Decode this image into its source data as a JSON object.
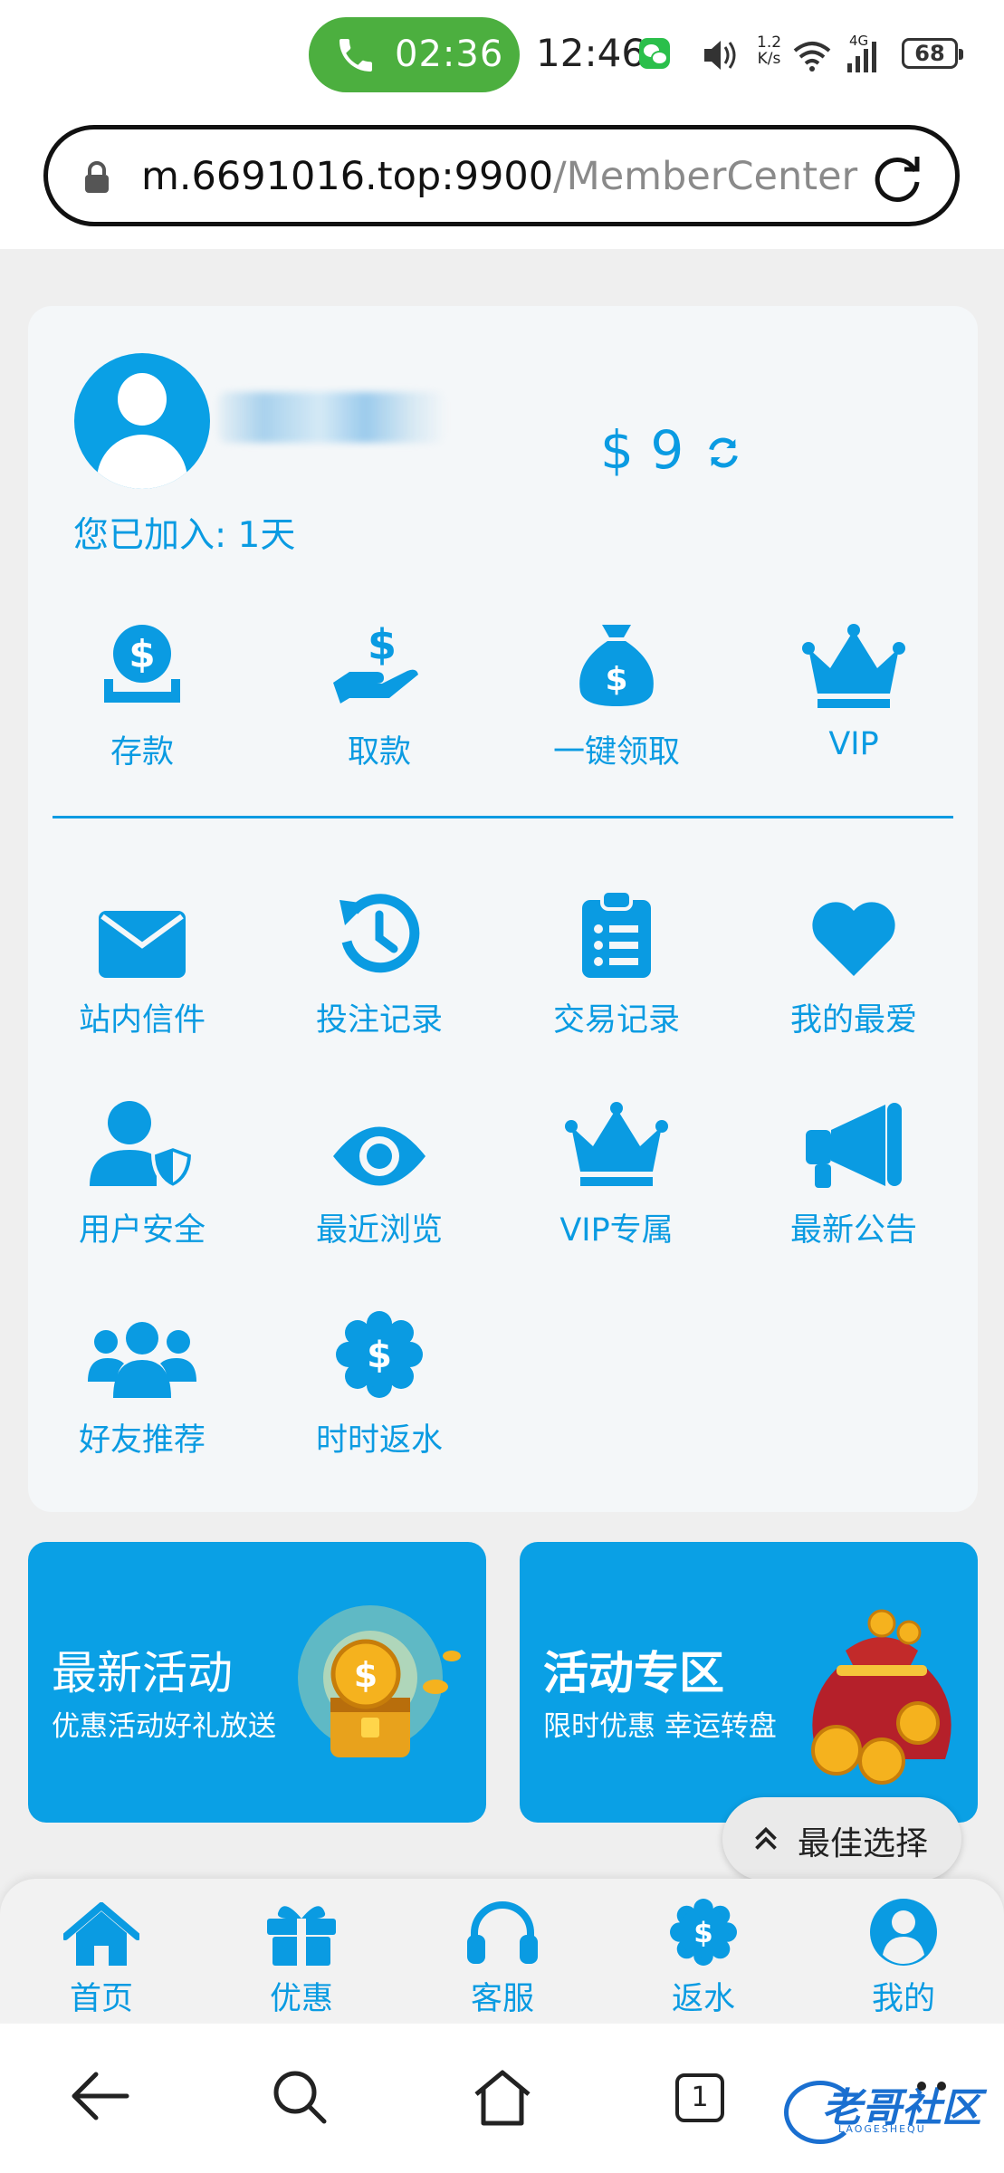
{
  "status_bar": {
    "call_time": "02:36",
    "clock": "12:46",
    "net_speed_value": "1.2",
    "net_speed_unit": "K/s",
    "network": "4G",
    "battery": "68"
  },
  "address_bar": {
    "host": "m.6691016.top:9900",
    "path": "/MemberCenter"
  },
  "member": {
    "joined": "您已加入: 1天",
    "balance": "$ 9"
  },
  "quick_actions": [
    {
      "label": "存款",
      "icon": "deposit-icon"
    },
    {
      "label": "取款",
      "icon": "withdraw-icon"
    },
    {
      "label": "一键领取",
      "icon": "money-bag-icon"
    },
    {
      "label": "VIP",
      "icon": "crown-icon"
    }
  ],
  "menu": [
    {
      "label": "站内信件",
      "icon": "envelope-icon"
    },
    {
      "label": "投注记录",
      "icon": "history-icon"
    },
    {
      "label": "交易记录",
      "icon": "clipboard-icon"
    },
    {
      "label": "我的最爱",
      "icon": "heart-icon"
    },
    {
      "label": "用户安全",
      "icon": "user-shield-icon"
    },
    {
      "label": "最近浏览",
      "icon": "eye-icon"
    },
    {
      "label": "VIP专属",
      "icon": "crown-icon"
    },
    {
      "label": "最新公告",
      "icon": "megaphone-icon"
    },
    {
      "label": "好友推荐",
      "icon": "users-icon"
    },
    {
      "label": "时时返水",
      "icon": "dollar-badge-icon"
    }
  ],
  "promos": [
    {
      "title": "最新活动",
      "subtitle": "优惠活动好礼放送"
    },
    {
      "title": "活动专区",
      "subtitle": "限时优惠 幸运转盘"
    }
  ],
  "best_choice": "最佳选择",
  "bottom_nav": [
    {
      "label": "首页",
      "icon": "home-icon"
    },
    {
      "label": "优惠",
      "icon": "gift-icon"
    },
    {
      "label": "客服",
      "icon": "headset-icon"
    },
    {
      "label": "返水",
      "icon": "dollar-badge-icon"
    },
    {
      "label": "我的",
      "icon": "user-circle-icon"
    }
  ],
  "browser": {
    "tab_count": "1"
  },
  "watermark": {
    "text": "老哥社区",
    "sub": "LAOGESHEQU"
  },
  "colors": {
    "accent": "#0a9be2",
    "call_green": "#4caf3f",
    "promo_bg": "#0aa0e5"
  }
}
